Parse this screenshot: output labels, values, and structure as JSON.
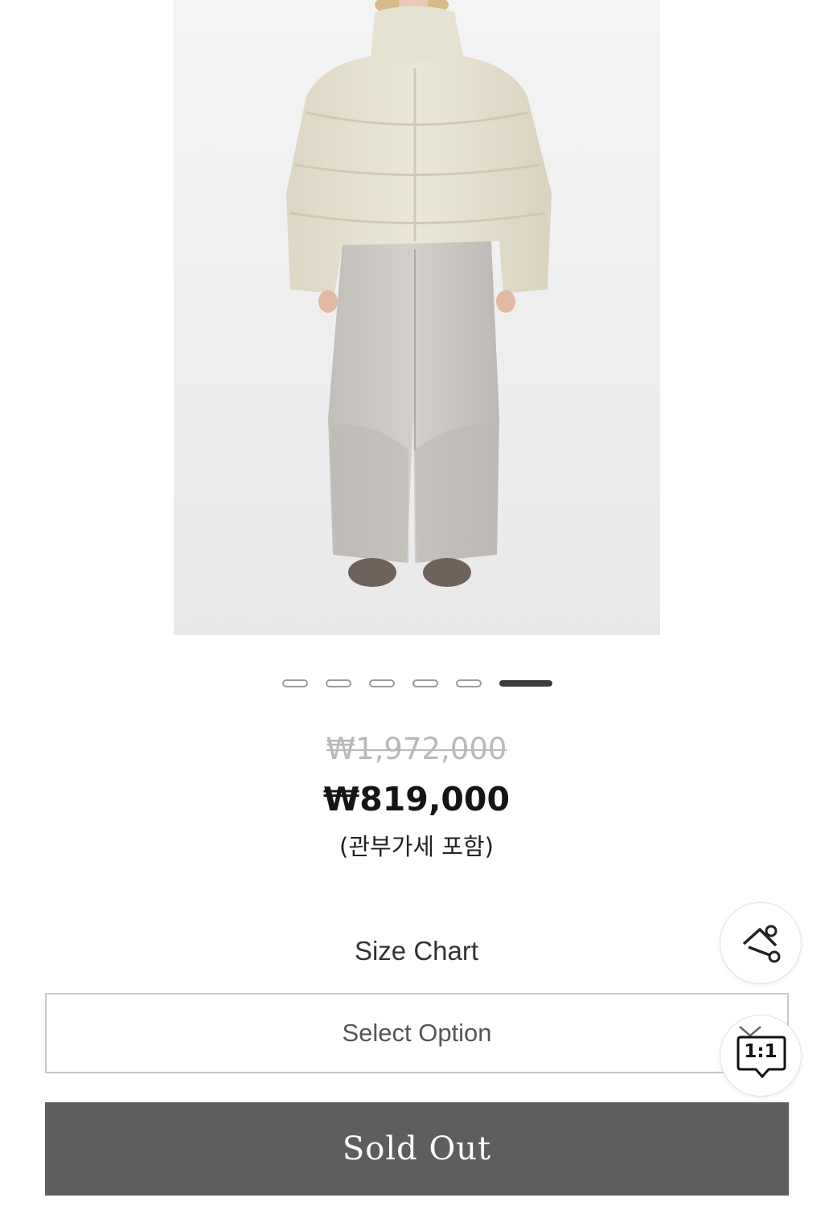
{
  "product": {
    "image_alt": "product-photo-puffer-jacket-and-wide-leg-jeans",
    "indicator_count": 6,
    "active_indicator": 6
  },
  "price": {
    "original": "₩1,972,000",
    "sale": "₩819,000",
    "note": "(관부가세 포함)"
  },
  "size_chart_label": "Size Chart",
  "select": {
    "placeholder": "Select Option"
  },
  "sold_out_label": "Sold Out",
  "floating": {
    "share_icon": "share-icon",
    "chat_label": "1:1"
  },
  "colors": {
    "sold_out_bg": "#5e5e5e",
    "jacket": "#e5e1d0",
    "jeans": "#c9c6c2"
  }
}
